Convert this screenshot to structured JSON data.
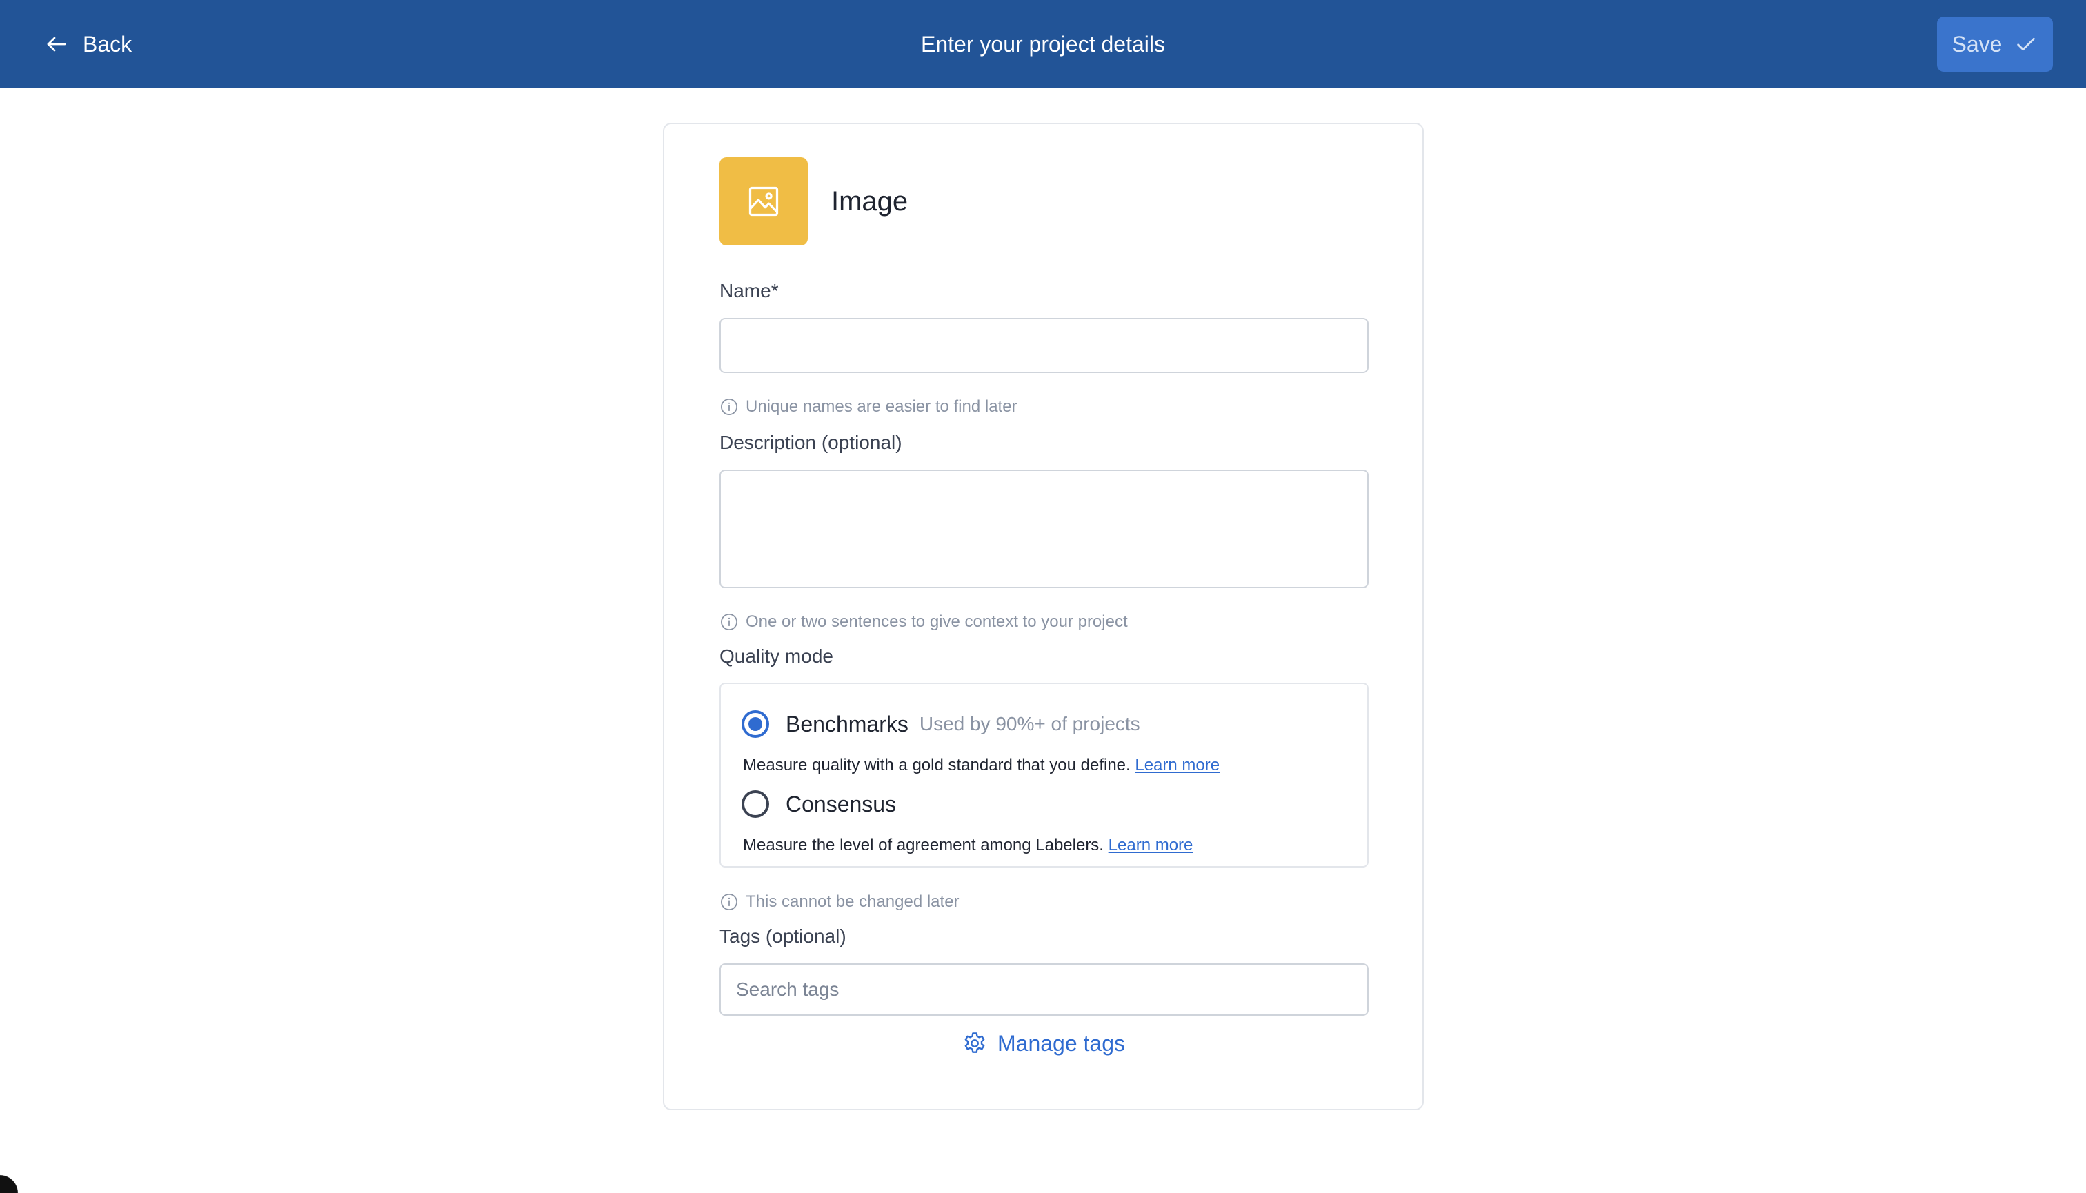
{
  "header": {
    "back_label": "Back",
    "title": "Enter your project details",
    "save_label": "Save"
  },
  "project_type": {
    "label": "Image",
    "icon": "image-icon",
    "tile_color": "#f0bd45"
  },
  "form": {
    "name": {
      "label": "Name*",
      "value": "",
      "hint": "Unique names are easier to find later"
    },
    "description": {
      "label": "Description (optional)",
      "value": "",
      "hint": "One or two sentences to give context to your project"
    },
    "quality_mode": {
      "label": "Quality mode",
      "options": [
        {
          "name": "Benchmarks",
          "note": "Used by 90%+ of projects",
          "description": "Measure quality with a gold standard that you define.",
          "link": "Learn more",
          "selected": true
        },
        {
          "name": "Consensus",
          "note": "",
          "description": "Measure the level of agreement among Labelers.",
          "link": "Learn more",
          "selected": false
        }
      ],
      "hint": "This cannot be changed later"
    },
    "tags": {
      "label": "Tags (optional)",
      "placeholder": "Search tags",
      "manage_label": "Manage tags"
    }
  },
  "colors": {
    "header_bg": "#225497",
    "save_bg": "#3a74cc",
    "accent": "#2f6bd0"
  }
}
